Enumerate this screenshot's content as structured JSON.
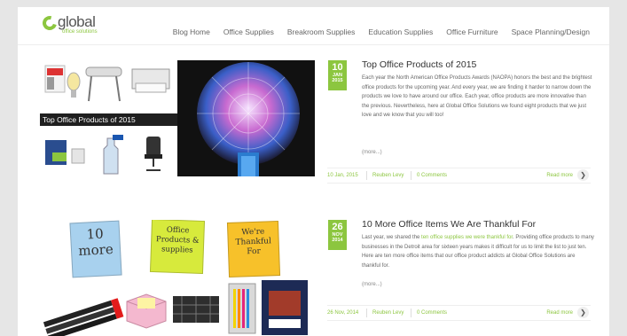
{
  "brand": {
    "name": "global",
    "tagline": "office solutions",
    "accent": "#8cc63f"
  },
  "nav": [
    {
      "label": "Blog Home"
    },
    {
      "label": "Office Supplies"
    },
    {
      "label": "Breakroom Supplies"
    },
    {
      "label": "Education Supplies"
    },
    {
      "label": "Office Furniture"
    },
    {
      "label": "Space Planning/Design"
    }
  ],
  "posts": [
    {
      "date": {
        "day": "10",
        "month": "JAN",
        "year": "2015"
      },
      "title": "Top Office Products of 2015",
      "image_caption": "Top Office Products of 2015",
      "excerpt": "Each year the North American Office Products Awards (NAOPA) honors the best and the brightest office products for the upcoming year. And every year, we are finding it harder to narrow down the products we love to have around our office. Each year, office products are more innovative than the previous. Nevertheless, here at Global Office Solutions we found eight products that we just love and we know that you will too!",
      "more": "(more...)",
      "meta": {
        "date": "10 Jan, 2015",
        "author": "Reuben Levy",
        "comments": "0 Comments",
        "read_more": "Read more"
      }
    },
    {
      "date": {
        "day": "26",
        "month": "NOV",
        "year": "2014"
      },
      "title": "10 More Office Items We Are Thankful For",
      "image_notes": [
        "10 more",
        "Office Products & supplies",
        "We're Thankful For"
      ],
      "excerpt_before": "Last year, we shared the ",
      "excerpt_link": "ten office supplies we were thankful for",
      "excerpt_after": ". Providing office products to many businesses in the Detroit area for sixteen years makes it difficult for us to limit the list to just ten. Here are ten more office items that our office product addicts at Global Office Solutions are thankful for.",
      "more": "(more...)",
      "meta": {
        "date": "26 Nov, 2014",
        "author": "Reuben Levy",
        "comments": "0 Comments",
        "read_more": "Read more"
      }
    }
  ]
}
